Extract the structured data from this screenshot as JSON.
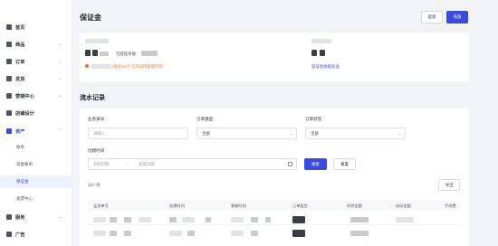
{
  "sidebar": {
    "items": [
      {
        "label": "首页",
        "icon": "home-icon",
        "expandable": false
      },
      {
        "label": "商品",
        "icon": "product-icon",
        "expandable": true
      },
      {
        "label": "订单",
        "icon": "order-icon",
        "expandable": true
      },
      {
        "label": "发货",
        "icon": "shipping-icon",
        "expandable": true
      },
      {
        "label": "营销中心",
        "icon": "marketing-icon",
        "expandable": true
      },
      {
        "label": "店铺设计",
        "icon": "shop-design-icon",
        "expandable": false
      },
      {
        "label": "资产",
        "icon": "assets-icon",
        "expandable": true,
        "active": true
      }
    ],
    "asset_sub_items": [
      {
        "label": "账单",
        "active": false
      },
      {
        "label": "资金账单",
        "active": false
      },
      {
        "label": "保证金",
        "active": true
      },
      {
        "label": "发票中心",
        "active": false
      }
    ],
    "bottom_items": [
      {
        "label": "服务",
        "icon": "service-icon",
        "expandable": true
      },
      {
        "label": "广告",
        "icon": "ad-icon",
        "expandable": false
      }
    ]
  },
  "deposit": {
    "title": "保证金",
    "withdraw_button": "提现",
    "recharge_button": "充值",
    "available_label": "可提现余额",
    "warning_text": ")会在3-5个工作日内处理完毕",
    "standard_link": "保证金收取标准"
  },
  "records": {
    "title": "流水记录",
    "filters": {
      "business_no_label": "业务单号",
      "business_no_placeholder": "请输入",
      "order_type_label": "订单类型",
      "order_type_value": "全部",
      "order_status_label": "订单状态",
      "order_status_value": "全部",
      "create_time_label": "创建时间",
      "start_date_placeholder": "开始日期",
      "end_date_placeholder": "结束日期",
      "search_button": "搜索",
      "reset_button": "重置"
    },
    "count_text": "127 条",
    "export_button": "导出",
    "columns": [
      "业务单号",
      "创建时间",
      "更新时间",
      "订单类型",
      "扣除金额",
      "实际金额",
      "手续费"
    ]
  },
  "colors": {
    "primary": "#3b4bdb",
    "warning": "#e36f1a"
  }
}
